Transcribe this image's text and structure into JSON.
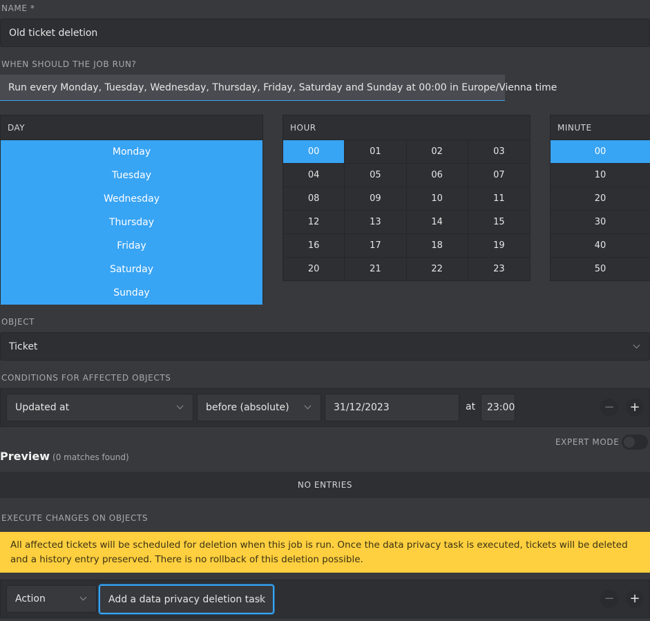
{
  "name": {
    "label": "NAME *",
    "value": "Old ticket deletion"
  },
  "schedule": {
    "label": "WHEN SHOULD THE JOB RUN?",
    "summary": "Run every Monday, Tuesday, Wednesday, Thursday, Friday, Saturday and Sunday at 00:00 in Europe/Vienna time",
    "accent_color": "#38a4f4",
    "day": {
      "header": "DAY",
      "items": [
        "Monday",
        "Tuesday",
        "Wednesday",
        "Thursday",
        "Friday",
        "Saturday",
        "Sunday"
      ],
      "selected": [
        "Monday",
        "Tuesday",
        "Wednesday",
        "Thursday",
        "Friday",
        "Saturday",
        "Sunday"
      ]
    },
    "hour": {
      "header": "HOUR",
      "items": [
        "00",
        "01",
        "02",
        "03",
        "04",
        "05",
        "06",
        "07",
        "08",
        "09",
        "10",
        "11",
        "12",
        "13",
        "14",
        "15",
        "16",
        "17",
        "18",
        "19",
        "20",
        "21",
        "22",
        "23"
      ],
      "selected": [
        "00"
      ]
    },
    "minute": {
      "header": "MINUTE",
      "items": [
        "00",
        "10",
        "20",
        "30",
        "40",
        "50"
      ],
      "selected": [
        "00"
      ]
    }
  },
  "object": {
    "label": "OBJECT",
    "value": "Ticket"
  },
  "conditions": {
    "label": "CONDITIONS FOR AFFECTED OBJECTS",
    "attribute": "Updated at",
    "operator": "before (absolute)",
    "date": "31/12/2023",
    "at_label": "at",
    "time": "23:00",
    "remove_symbol": "−",
    "add_symbol": "+"
  },
  "expert_mode": {
    "label": "EXPERT MODE",
    "enabled": false
  },
  "preview": {
    "title": "Preview",
    "count_text": "(0 matches found)",
    "empty_text": "NO ENTRIES"
  },
  "execute": {
    "label": "EXECUTE CHANGES ON OBJECTS",
    "warning": "All affected tickets will be scheduled for deletion when this job is run. Once the data privacy task is executed, tickets will be deleted and a history entry preserved. There is no rollback of this deletion possible.",
    "warning_color": "#fecf3e",
    "action_label": "Action",
    "action_value": "Add a data privacy deletion task",
    "remove_symbol": "−",
    "add_symbol": "+"
  }
}
